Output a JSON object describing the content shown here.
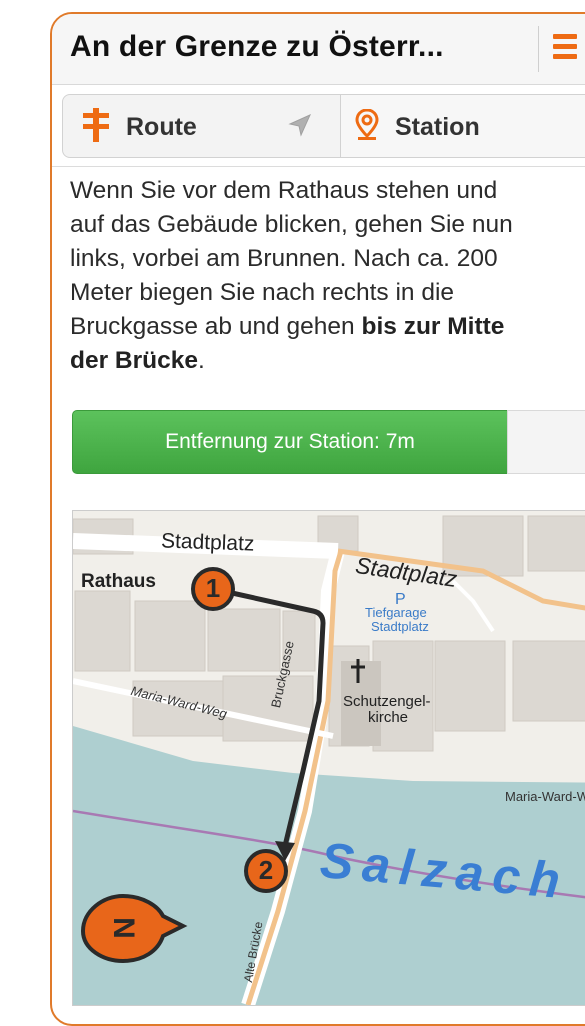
{
  "header": {
    "title": "An der Grenze zu Österr..."
  },
  "tabs": {
    "route_label": "Route",
    "station_label": "Station"
  },
  "description": {
    "line1": "Wenn Sie vor dem Rathaus stehen und",
    "line2": "auf das Gebäude blicken, gehen Sie nun",
    "line3": "links, vorbei am Brunnen. Nach ca. 200",
    "line4": "Meter biegen Sie nach rechts in die",
    "line5_plain": "Bruckgasse ab und gehen ",
    "line5_bold": "bis zur Mitte",
    "line6_bold": "der Brücke",
    "line6_end": "."
  },
  "distance": {
    "label": "Entfernung zur Station: 7m"
  },
  "map": {
    "labels": {
      "stadtplatz_1": "Stadtplatz",
      "stadtplatz_2": "Stadtplatz",
      "rathaus": "Rathaus",
      "parking_p": "P",
      "tiefgarage_1": "Tiefgarage",
      "tiefgarage_2": "Stadtplatz",
      "schutzengel_1": "Schutzengel-",
      "schutzengel_2": "kirche",
      "bruckgasse": "Bruckgasse",
      "maria_ward_weg": "Maria-Ward-Weg",
      "maria_ward_right": "Maria-Ward-W",
      "salzach": "Salzach",
      "alte_bruecke": "Alte Brücke"
    },
    "markers": {
      "start": "1",
      "end": "2",
      "compass": "N"
    }
  },
  "colors": {
    "accent": "#ee6b13",
    "frame": "#e07a2a",
    "distance_bar": "#4cb34c",
    "river": "#aecfd0",
    "route": "#2a2a2a",
    "marker": "#e8661a"
  }
}
